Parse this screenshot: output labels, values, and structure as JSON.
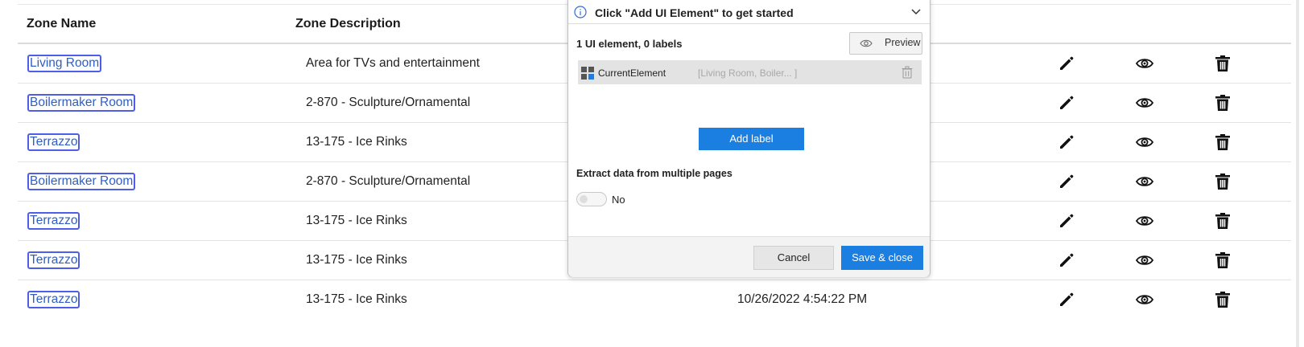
{
  "table": {
    "headers": {
      "zone_name": "Zone Name",
      "zone_description": "Zone Description"
    },
    "rows": [
      {
        "name": "Living Room",
        "description": "Area for TVs and entertainment",
        "date": ""
      },
      {
        "name": "Boilermaker Room",
        "description": "2-870 - Sculpture/Ornamental",
        "date": ""
      },
      {
        "name": "Terrazzo",
        "description": "13-175 - Ice Rinks",
        "date": ""
      },
      {
        "name": "Boilermaker Room",
        "description": "2-870 - Sculpture/Ornamental",
        "date": ""
      },
      {
        "name": "Terrazzo",
        "description": "13-175 - Ice Rinks",
        "date": ""
      },
      {
        "name": "Terrazzo",
        "description": "13-175 - Ice Rinks",
        "date": ""
      },
      {
        "name": "Terrazzo",
        "description": "13-175 - Ice Rinks",
        "date": "10/26/2022 4:54:22 PM"
      }
    ],
    "row_actions": [
      "edit-icon",
      "view-icon",
      "delete-icon"
    ]
  },
  "dialog": {
    "title": "Click \"Add UI Element\" to get started",
    "summary": "1 UI element, 0 labels",
    "preview_label": "Preview",
    "element": {
      "name": "CurrentElement",
      "value": "[Living Room, Boiler... ]"
    },
    "add_label": "Add label",
    "extract_label": "Extract data from multiple pages",
    "toggle_state": "No",
    "cancel_label": "Cancel",
    "save_label": "Save & close"
  },
  "colors": {
    "accent": "#1a7fe0",
    "link": "#2f5fc4",
    "link_border": "#4f5ee8"
  }
}
